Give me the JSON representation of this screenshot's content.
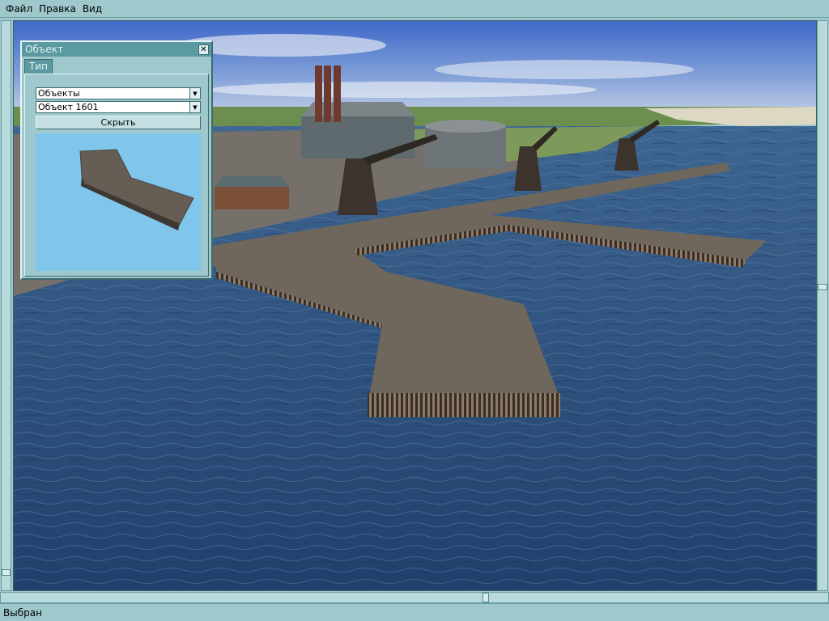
{
  "menu": {
    "items": [
      {
        "label": "Файл"
      },
      {
        "label": "Правка"
      },
      {
        "label": "Вид"
      }
    ]
  },
  "object_panel": {
    "title": "Объект",
    "close_glyph": "✕",
    "tab_label": "Тип",
    "category_select": {
      "value": "Объекты"
    },
    "object_select": {
      "value": "Объект 1601"
    },
    "hide_button_label": "Скрыть"
  },
  "statusbar": {
    "text": "Выбран"
  },
  "colors": {
    "ui_background": "#9ec8cc",
    "titlebar": "#5a9aa0",
    "preview_background": "#7fc6ea",
    "water": "#2f5680",
    "pier": "#6f665c"
  },
  "icons": {
    "dropdown_arrow": "▼",
    "scroll_up": "▲",
    "scroll_down": "▼",
    "scroll_left": "◀",
    "scroll_right": "▶"
  }
}
